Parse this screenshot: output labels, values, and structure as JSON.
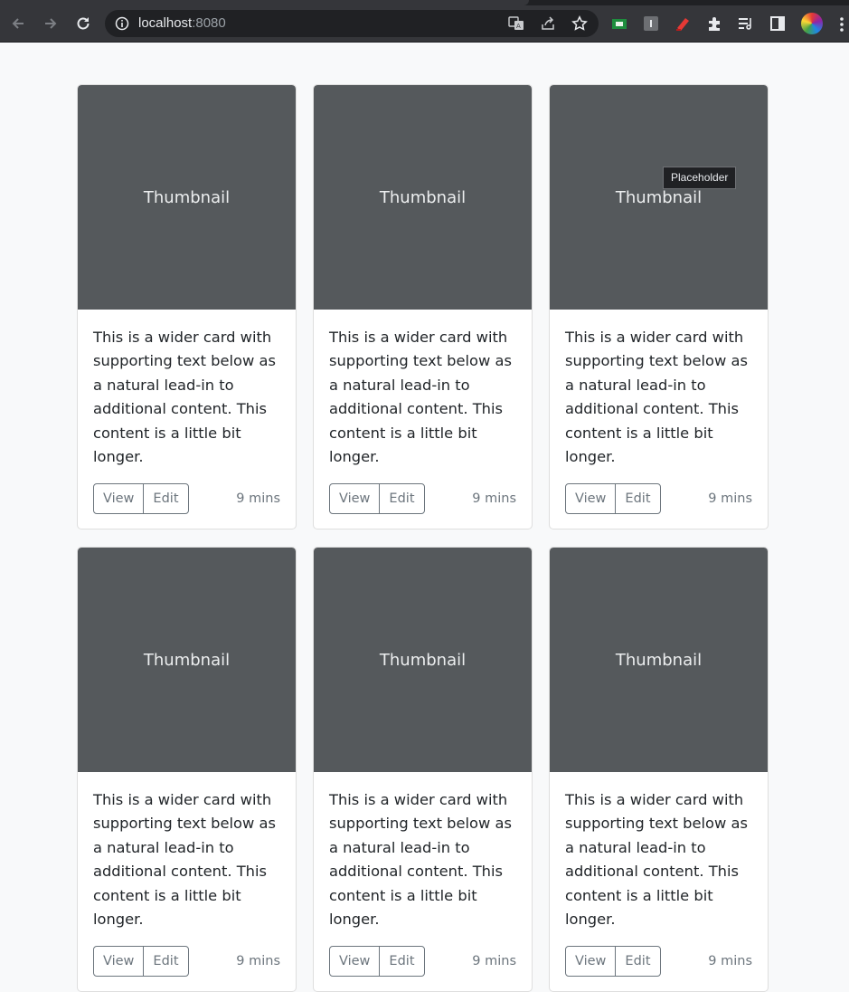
{
  "browser": {
    "url_host": "localhost",
    "url_port": ":8080",
    "icons": [
      "back-icon",
      "forward-icon",
      "reload-icon",
      "site-info-icon",
      "translate-icon",
      "share-icon",
      "bookmark-star-icon",
      "extension-green-icon",
      "extension-grey-icon",
      "extension-red-icon",
      "extensions-puzzle-icon",
      "media-control-icon",
      "side-panel-icon",
      "profile-avatar",
      "menu-dots-icon"
    ]
  },
  "tooltip": "Placeholder",
  "cards": [
    {
      "thumb": "Thumbnail",
      "text": "This is a wider card with supporting text below as a natural lead-in to additional content. This content is a little bit longer.",
      "view": "View",
      "edit": "Edit",
      "time": "9 mins"
    },
    {
      "thumb": "Thumbnail",
      "text": "This is a wider card with supporting text below as a natural lead-in to additional content. This content is a little bit longer.",
      "view": "View",
      "edit": "Edit",
      "time": "9 mins"
    },
    {
      "thumb": "Thumbnail",
      "text": "This is a wider card with supporting text below as a natural lead-in to additional content. This content is a little bit longer.",
      "view": "View",
      "edit": "Edit",
      "time": "9 mins"
    },
    {
      "thumb": "Thumbnail",
      "text": "This is a wider card with supporting text below as a natural lead-in to additional content. This content is a little bit longer.",
      "view": "View",
      "edit": "Edit",
      "time": "9 mins"
    },
    {
      "thumb": "Thumbnail",
      "text": "This is a wider card with supporting text below as a natural lead-in to additional content. This content is a little bit longer.",
      "view": "View",
      "edit": "Edit",
      "time": "9 mins"
    },
    {
      "thumb": "Thumbnail",
      "text": "This is a wider card with supporting text below as a natural lead-in to additional content. This content is a little bit longer.",
      "view": "View",
      "edit": "Edit",
      "time": "9 mins"
    }
  ],
  "colors": {
    "thumbnail_bg": "#55595c",
    "button_border": "#6c757d",
    "page_bg": "#f8f9fa",
    "browser_toolbar": "#35363a"
  }
}
